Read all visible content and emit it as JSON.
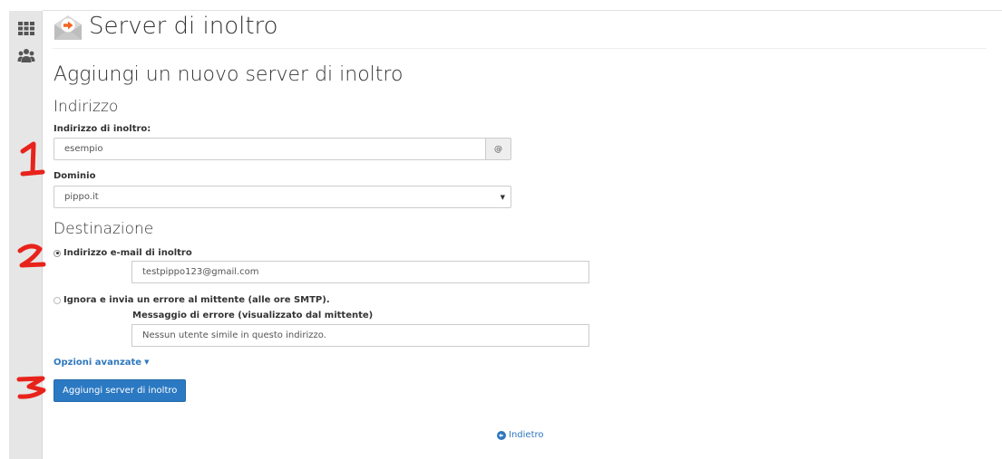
{
  "page": {
    "title": "Server di inoltro",
    "subtitle": "Aggiungi un nuovo server di inoltro"
  },
  "sidebar": {
    "items": [
      {
        "icon": "grid-icon"
      },
      {
        "icon": "users-icon"
      }
    ]
  },
  "address_section": {
    "heading": "Indirizzo",
    "forward_label": "Indirizzo di inoltro:",
    "forward_value": "esempio",
    "at_symbol": "@",
    "domain_label": "Dominio",
    "domain_selected": "pippo.it"
  },
  "destination_section": {
    "heading": "Destinazione",
    "option_forward_label": "Indirizzo e-mail di inoltro",
    "option_forward_checked": true,
    "forward_email_value": "testpippo123@gmail.com",
    "option_fail_label": "Ignora e invia un errore al mittente (alle ore SMTP).",
    "option_fail_checked": false,
    "error_message_label": "Messaggio di errore (visualizzato dal mittente)",
    "error_message_value": "Nessun utente simile in questo indirizzo."
  },
  "advanced_options_label": "Opzioni avanzate",
  "submit_button_label": "Aggiungi server di inoltro",
  "back_link_label": "Indietro",
  "annotations": [
    "1",
    "2",
    "3"
  ],
  "colors": {
    "link": "#2f78bd",
    "button": "#2b79c2",
    "annotation": "#e8231b"
  }
}
